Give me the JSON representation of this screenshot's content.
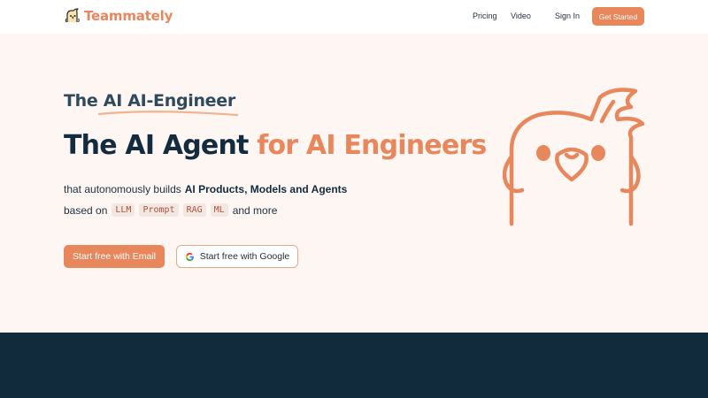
{
  "nav": {
    "brand": "Teammately",
    "links": {
      "pricing": "Pricing",
      "video": "Video",
      "signin": "Sign In"
    },
    "cta": "Get Started"
  },
  "hero": {
    "eyebrow": "The AI AI-Engineer",
    "headline_main": "The AI Agent ",
    "headline_accent": "for AI Engineers",
    "subline_prefix": "that autonomously builds",
    "subline_bold": "AI Products, Models and Agents",
    "subline2_prefix": "based on",
    "tags": [
      "LLM",
      "Prompt",
      "RAG",
      "ML"
    ],
    "subline2_suffix": "and more",
    "buttons": {
      "email": "Start free with Email",
      "google": "Start free with Google"
    },
    "illustration_icon": "cockatiel-mascot-icon"
  },
  "colors": {
    "accent": "#e8865c",
    "dark": "#122b3e",
    "hero_bg": "#fdf6f3",
    "band_bg": "#112b3d"
  }
}
